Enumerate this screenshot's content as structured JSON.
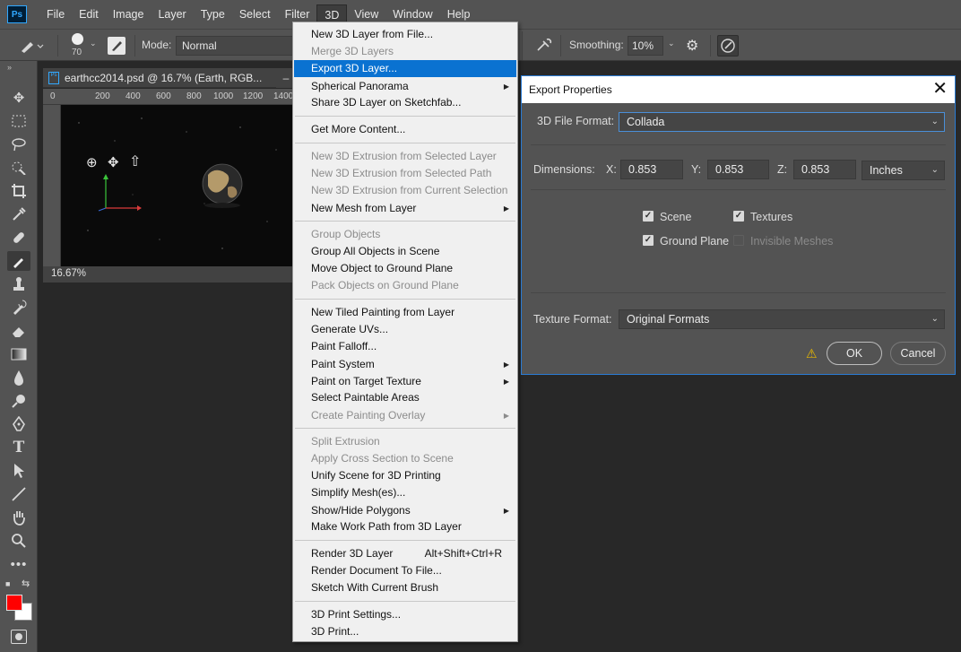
{
  "app": {
    "logo": "Ps"
  },
  "menubar": {
    "items": [
      "File",
      "Edit",
      "Image",
      "Layer",
      "Type",
      "Select",
      "Filter",
      "3D",
      "View",
      "Window",
      "Help"
    ],
    "active": "3D"
  },
  "options": {
    "brush_size": "70",
    "mode_label": "Mode:",
    "mode_value": "Normal",
    "smoothing_label": "Smoothing:",
    "smoothing_value": "10%"
  },
  "document": {
    "title": "earthcc2014.psd @ 16.7% (Earth, RGB...",
    "ruler_ticks": [
      "0",
      "200",
      "400",
      "600",
      "800",
      "1000",
      "1200",
      "1400"
    ],
    "zoom": "16.67%"
  },
  "menu3d": {
    "items": [
      {
        "label": "New 3D Layer from File...",
        "disabled": false,
        "submenu": false,
        "shortcut": ""
      },
      {
        "label": "Merge 3D Layers",
        "disabled": true,
        "submenu": false,
        "shortcut": ""
      },
      {
        "label": "Export 3D Layer...",
        "disabled": false,
        "submenu": false,
        "highlighted": true,
        "shortcut": ""
      },
      {
        "label": "Spherical Panorama",
        "disabled": false,
        "submenu": true,
        "shortcut": ""
      },
      {
        "label": "Share 3D Layer on Sketchfab...",
        "disabled": false,
        "submenu": false,
        "shortcut": ""
      },
      {
        "label": "Get More Content...",
        "disabled": false,
        "submenu": false,
        "shortcut": ""
      },
      {
        "label": "New 3D Extrusion from Selected Layer",
        "disabled": true,
        "submenu": false,
        "shortcut": ""
      },
      {
        "label": "New 3D Extrusion from Selected Path",
        "disabled": true,
        "submenu": false,
        "shortcut": ""
      },
      {
        "label": "New 3D Extrusion from Current Selection",
        "disabled": true,
        "submenu": false,
        "shortcut": ""
      },
      {
        "label": "New Mesh from Layer",
        "disabled": false,
        "submenu": true,
        "shortcut": ""
      },
      {
        "label": "Group Objects",
        "disabled": true,
        "submenu": false,
        "shortcut": ""
      },
      {
        "label": "Group All Objects in Scene",
        "disabled": false,
        "submenu": false,
        "shortcut": ""
      },
      {
        "label": "Move Object to Ground Plane",
        "disabled": false,
        "submenu": false,
        "shortcut": ""
      },
      {
        "label": "Pack Objects on Ground Plane",
        "disabled": true,
        "submenu": false,
        "shortcut": ""
      },
      {
        "label": "New Tiled Painting from Layer",
        "disabled": false,
        "submenu": false,
        "shortcut": ""
      },
      {
        "label": "Generate UVs...",
        "disabled": false,
        "submenu": false,
        "shortcut": ""
      },
      {
        "label": "Paint Falloff...",
        "disabled": false,
        "submenu": false,
        "shortcut": ""
      },
      {
        "label": "Paint System",
        "disabled": false,
        "submenu": true,
        "shortcut": ""
      },
      {
        "label": "Paint on Target Texture",
        "disabled": false,
        "submenu": true,
        "shortcut": ""
      },
      {
        "label": "Select Paintable Areas",
        "disabled": false,
        "submenu": false,
        "shortcut": ""
      },
      {
        "label": "Create Painting Overlay",
        "disabled": true,
        "submenu": true,
        "shortcut": ""
      },
      {
        "label": "Split Extrusion",
        "disabled": true,
        "submenu": false,
        "shortcut": ""
      },
      {
        "label": "Apply Cross Section to Scene",
        "disabled": true,
        "submenu": false,
        "shortcut": ""
      },
      {
        "label": "Unify Scene for 3D Printing",
        "disabled": false,
        "submenu": false,
        "shortcut": ""
      },
      {
        "label": "Simplify Mesh(es)...",
        "disabled": false,
        "submenu": false,
        "shortcut": ""
      },
      {
        "label": "Show/Hide Polygons",
        "disabled": false,
        "submenu": true,
        "shortcut": ""
      },
      {
        "label": "Make Work Path from 3D Layer",
        "disabled": false,
        "submenu": false,
        "shortcut": ""
      },
      {
        "label": "Render 3D Layer",
        "disabled": false,
        "submenu": false,
        "shortcut": "Alt+Shift+Ctrl+R"
      },
      {
        "label": "Render Document To File...",
        "disabled": false,
        "submenu": false,
        "shortcut": ""
      },
      {
        "label": "Sketch With Current Brush",
        "disabled": false,
        "submenu": false,
        "shortcut": ""
      },
      {
        "label": "3D Print Settings...",
        "disabled": false,
        "submenu": false,
        "shortcut": ""
      },
      {
        "label": "3D Print...",
        "disabled": false,
        "submenu": false,
        "shortcut": ""
      }
    ]
  },
  "dialog": {
    "title": "Export Properties",
    "file_format_label": "3D File Format:",
    "file_format_value": "Collada",
    "dimensions_label": "Dimensions:",
    "x_label": "X:",
    "x_value": "0.853",
    "y_label": "Y:",
    "y_value": "0.853",
    "z_label": "Z:",
    "z_value": "0.853",
    "unit_value": "Inches",
    "checkboxes": {
      "scene": {
        "label": "Scene",
        "checked": true
      },
      "textures": {
        "label": "Textures",
        "checked": true
      },
      "ground_plane": {
        "label": "Ground Plane",
        "checked": true
      },
      "invisible_meshes": {
        "label": "Invisible Meshes",
        "checked": false
      }
    },
    "texture_format_label": "Texture Format:",
    "texture_format_value": "Original Formats",
    "ok_label": "OK",
    "cancel_label": "Cancel"
  },
  "colors": {
    "highlight": "#0a72d1",
    "foreground_swatch": "#ff0000",
    "background_swatch": "#ffffff",
    "warning": "#e8b800"
  }
}
